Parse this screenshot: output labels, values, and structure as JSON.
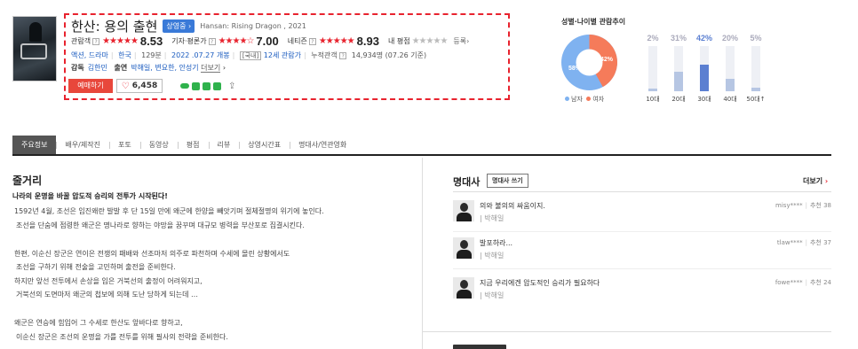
{
  "movie": {
    "title": "한산: 용의 출현",
    "status_badge": "상영중 ›",
    "english_title": "Hansan: Rising Dragon , 2021",
    "ratings": [
      {
        "label": "관람객",
        "stars": "★★★★★",
        "score": "8.53"
      },
      {
        "label": "기자·평론가",
        "stars": "★★★★☆",
        "score": "7.00"
      },
      {
        "label": "네티즌",
        "stars": "★★★★★",
        "score": "8.93"
      }
    ],
    "my_rating_label": "내 평점",
    "my_rating_stars": "★★★★★",
    "enroll_label": "등록›",
    "qmark": "?",
    "genres": "액션, 드라마",
    "country": "한국",
    "runtime": "129분",
    "release": "2022 .07.27 개봉",
    "grade_box": "[국내]",
    "grade": "12세 관람가",
    "audience_label": "누적관객",
    "audience": "14,934명",
    "audience_date": "(07.26 기준)",
    "director_label": "감독",
    "director": "김한민",
    "cast_label": "출연",
    "cast": "박해일, 변요한, 안성기",
    "more_cast": "더보기",
    "more_cast_chevron": "›",
    "reserve_label": "예매하기",
    "like_count": "6,458",
    "share_icon": "share-icon"
  },
  "stats": {
    "title": "성별·나이별 관람추이",
    "gender": {
      "male_pct": "58%",
      "female_pct": "42%",
      "male_label": "남자",
      "female_label": "여자",
      "male_color": "#7fb2f0",
      "female_color": "#f57b5a"
    },
    "age": [
      {
        "pct": "2%",
        "value": 2,
        "label": "10대"
      },
      {
        "pct": "31%",
        "value": 31,
        "label": "20대"
      },
      {
        "pct": "42%",
        "value": 42,
        "label": "30대",
        "highlight": true
      },
      {
        "pct": "20%",
        "value": 20,
        "label": "40대"
      },
      {
        "pct": "5%",
        "value": 5,
        "label": "50대↑"
      }
    ]
  },
  "tabs": [
    "주요정보",
    "배우/제작진",
    "포토",
    "동영상",
    "평점",
    "리뷰",
    "상영시간표",
    "명대사/연관영화"
  ],
  "synopsis": {
    "title": "줄거리",
    "headline": "나라의 운명을 바꿀 압도적 승리의 전투가 시작된다!",
    "lines": [
      "1592년 4월, 조선은 임진왜란 발발 후 단 15일 만에 왜군에 한양을 빼앗기며 절체절명의 위기에 놓인다.",
      "조선을 단숨에 점령한 왜군은 명나라로 향하는 야망을 꿈꾸며 대규모 병력을 부산포로 집결시킨다.",
      "",
      "한편, 이순신 장군은 연이은 전쟁의 패배와 선조마저 의주로 파천하며 수세에 몰린 상황에서도",
      "조선을 구하기 위해 전술을 고민하며 출전을 준비한다.",
      "하지만 앞선 전투에서 손상을 입은 거북선의 출정이 어려워지고,",
      "거북선의 도면마저 왜군의 첩보에 의해 도난 당하게 되는데 …",
      "",
      "왜군은 연승에 힘입어 그 수세로 한산도 앞바다로 향하고,",
      "이순신 장군은 조선의 운명을 가를 전투를 위해 필사의 전략을 준비한다."
    ]
  },
  "quotes": {
    "title": "명대사",
    "write_button": "명대사 쓰기",
    "more_label": "더보기",
    "more_chevron": "›",
    "items": [
      {
        "text": "의와 불의의 싸움이지.",
        "actor": "| 박해일",
        "user": "misy****",
        "recommend": "추천",
        "count": "38"
      },
      {
        "text": "발포하라...",
        "actor": "| 박해일",
        "user": "tlaw****",
        "recommend": "추천",
        "count": "37"
      },
      {
        "text": "지금 우리에겐 압도적인 승리가 필요하다",
        "actor": "| 박해일",
        "user": "fowe****",
        "recommend": "추천",
        "count": "24"
      }
    ]
  }
}
